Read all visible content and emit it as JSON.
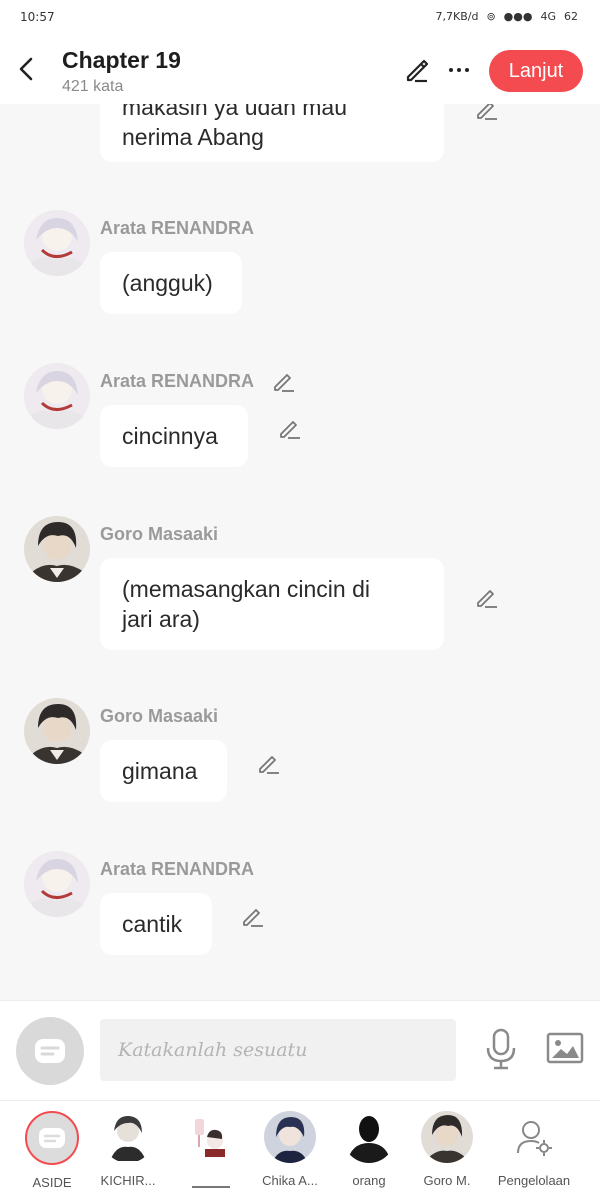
{
  "status": {
    "time": "10:57",
    "net_speed": "7,7KB/d",
    "signal": "●●●",
    "network": "4G",
    "battery": "62"
  },
  "header": {
    "title": "Chapter 19",
    "subtitle": "421 kata",
    "next_label": "Lanjut"
  },
  "messages": [
    {
      "author": "",
      "text": "makasih ya udah mau\nnerima Abang",
      "avatar": "none"
    },
    {
      "author": "Arata RENANDRA",
      "text": "(angguk)",
      "avatar": "arata"
    },
    {
      "author": "Arata RENANDRA",
      "text": "cincinnya",
      "avatar": "arata"
    },
    {
      "author": "Goro Masaaki",
      "text": "(memasangkan cincin di\njari ara)",
      "avatar": "goro"
    },
    {
      "author": "Goro Masaaki",
      "text": "gimana",
      "avatar": "goro"
    },
    {
      "author": "Arata RENANDRA",
      "text": "cantik",
      "avatar": "arata"
    }
  ],
  "composer": {
    "placeholder": "Katakanlah sesuatu"
  },
  "characters": [
    {
      "name": "ASIDE",
      "active": true
    },
    {
      "name": "KICHIR..."
    },
    {
      "name": ""
    },
    {
      "name": "Chika A..."
    },
    {
      "name": "orang"
    },
    {
      "name": "Goro M."
    },
    {
      "name": "Pengelolaan"
    }
  ],
  "colors": {
    "accent": "#f34b4f",
    "background": "#f7f7f7",
    "bubble": "#ffffff",
    "author": "#9a9a9a"
  }
}
